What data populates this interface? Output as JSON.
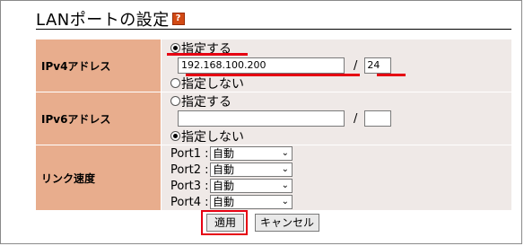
{
  "page": {
    "title": "LANポートの設定",
    "help_icon": "?"
  },
  "ipv4": {
    "label": "IPv4アドレス",
    "option_specify": "指定する",
    "option_none": "指定しない",
    "address": "192.168.100.200",
    "separator": "/",
    "prefix": "24",
    "selected": "specify"
  },
  "ipv6": {
    "label": "IPv6アドレス",
    "option_specify": "指定する",
    "option_none": "指定しない",
    "address": "",
    "separator": "/",
    "prefix": "",
    "selected": "none"
  },
  "link_speed": {
    "label": "リンク速度",
    "ports": [
      {
        "label": "Port1 :",
        "value": "自動"
      },
      {
        "label": "Port2 :",
        "value": "自動"
      },
      {
        "label": "Port3 :",
        "value": "自動"
      },
      {
        "label": "Port4 :",
        "value": "自動"
      }
    ]
  },
  "buttons": {
    "apply": "適用",
    "cancel": "キャンセル"
  },
  "colors": {
    "label_bg": "#e8ad8d",
    "value_bg": "#efe9e7",
    "highlight": "#e60012"
  }
}
